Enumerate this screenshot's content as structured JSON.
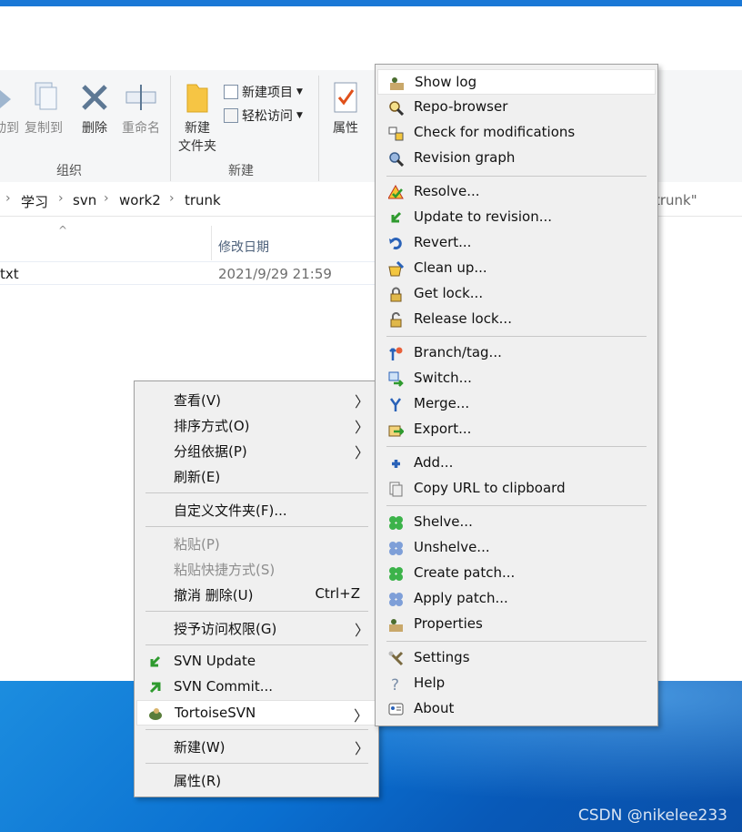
{
  "explorer": {
    "ribbon": {
      "copy_to_partial": "动到",
      "copy_to": "复制到",
      "delete": "删除",
      "rename": "重命名",
      "new_folder_line1": "新建",
      "new_folder_line2": "文件夹",
      "new_item": "新建项目",
      "easy_access": "轻松访问",
      "properties": "属性",
      "group_organize": "组织",
      "group_new": "新建"
    },
    "breadcrumbs": [
      "学习",
      "svn",
      "work2",
      "trunk"
    ],
    "search_placeholder_tail": "trunk\"",
    "column_date": "修改日期",
    "file": {
      "name": "txt",
      "modified": "2021/9/29 21:59"
    }
  },
  "context_menu": {
    "items": [
      {
        "label": "查看(V)",
        "submenu": true
      },
      {
        "label": "排序方式(O)",
        "submenu": true
      },
      {
        "label": "分组依据(P)",
        "submenu": true
      },
      {
        "label": "刷新(E)"
      },
      {
        "label": "自定义文件夹(F)..."
      },
      {
        "label": "粘贴(P)",
        "disabled": true
      },
      {
        "label": "粘贴快捷方式(S)",
        "disabled": true
      },
      {
        "label": "撤消 删除(U)",
        "shortcut": "Ctrl+Z"
      },
      {
        "label": "授予访问权限(G)",
        "submenu": true
      },
      {
        "label": "SVN Update",
        "icon": "svn-update-icon"
      },
      {
        "label": "SVN Commit...",
        "icon": "svn-commit-icon"
      },
      {
        "label": "TortoiseSVN",
        "icon": "tortoisesvn-icon",
        "submenu": true
      },
      {
        "label": "新建(W)",
        "submenu": true
      },
      {
        "label": "属性(R)"
      }
    ]
  },
  "tortoise_menu": {
    "items": [
      {
        "label": "Show log",
        "icon": "show-log-icon"
      },
      {
        "label": "Repo-browser",
        "icon": "repo-browser-icon"
      },
      {
        "label": "Check for modifications",
        "icon": "check-modifications-icon"
      },
      {
        "label": "Revision graph",
        "icon": "revision-graph-icon"
      },
      {
        "label": "Resolve...",
        "icon": "resolve-icon"
      },
      {
        "label": "Update to revision...",
        "icon": "update-revision-icon"
      },
      {
        "label": "Revert...",
        "icon": "revert-icon"
      },
      {
        "label": "Clean up...",
        "icon": "cleanup-icon"
      },
      {
        "label": "Get lock...",
        "icon": "lock-icon"
      },
      {
        "label": "Release lock...",
        "icon": "unlock-icon"
      },
      {
        "label": "Branch/tag...",
        "icon": "branch-icon"
      },
      {
        "label": "Switch...",
        "icon": "switch-icon"
      },
      {
        "label": "Merge...",
        "icon": "merge-icon"
      },
      {
        "label": "Export...",
        "icon": "export-icon"
      },
      {
        "label": "Add...",
        "icon": "add-icon"
      },
      {
        "label": "Copy URL to clipboard",
        "icon": "copy-url-icon"
      },
      {
        "label": "Shelve...",
        "icon": "shelve-icon"
      },
      {
        "label": "Unshelve...",
        "icon": "unshelve-icon"
      },
      {
        "label": "Create patch...",
        "icon": "create-patch-icon"
      },
      {
        "label": "Apply patch...",
        "icon": "apply-patch-icon"
      },
      {
        "label": "Properties",
        "icon": "properties-icon"
      },
      {
        "label": "Settings",
        "icon": "settings-icon"
      },
      {
        "label": "Help",
        "icon": "help-icon"
      },
      {
        "label": "About",
        "icon": "about-icon"
      }
    ]
  },
  "watermark": "CSDN @nikelee233"
}
